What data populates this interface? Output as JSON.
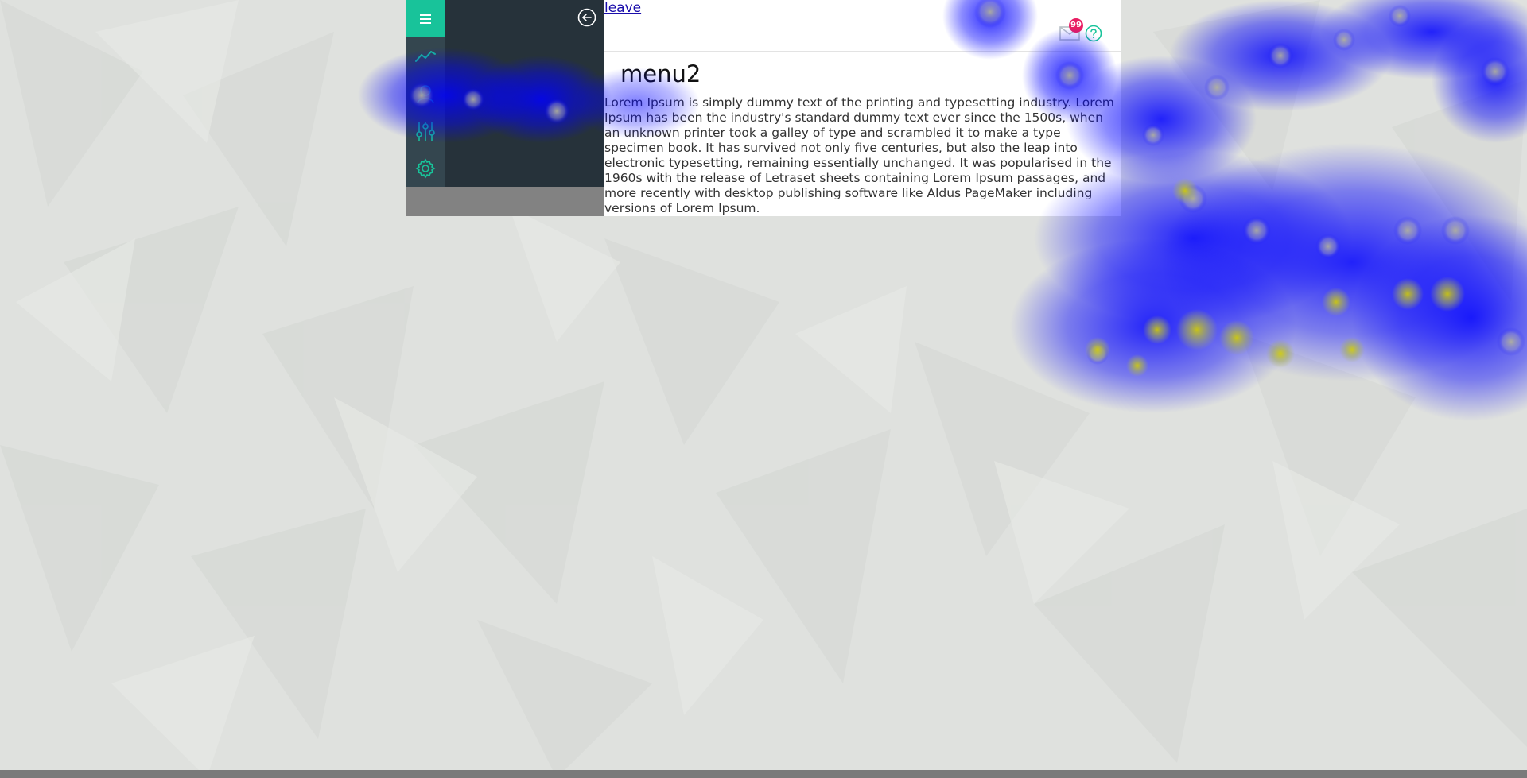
{
  "header": {
    "leave_link": "leave",
    "notification_count": "99"
  },
  "sidebar": {
    "menu_icon": "hamburger-icon",
    "back_icon": "arrow-left-circle-icon",
    "items": [
      {
        "icon": "trending-chart-icon"
      },
      {
        "icon": "user-profile-icon"
      },
      {
        "icon": "sliders-icon"
      },
      {
        "icon": "gear-icon"
      }
    ]
  },
  "main": {
    "title": "menu2",
    "body": "Lorem Ipsum is simply dummy text of the printing and typesetting industry. Lorem Ipsum has been the industry's standard dummy text ever since the 1500s, when an unknown printer took a galley of type and scrambled it to make a type specimen book. It has survived not only five centuries, but also the leap into electronic typesetting, remaining essentially unchanged. It was popularised in the 1960s with the release of Letraset sheets containing Lorem Ipsum passages, and more recently with desktop publishing software like Aldus PageMaker including versions of Lorem Ipsum."
  },
  "colors": {
    "accent": "#18c39a",
    "rail": "#34464f",
    "panel": "#26323a",
    "badge": "#e91e63",
    "heatmap_overlay": "#0000ff"
  }
}
